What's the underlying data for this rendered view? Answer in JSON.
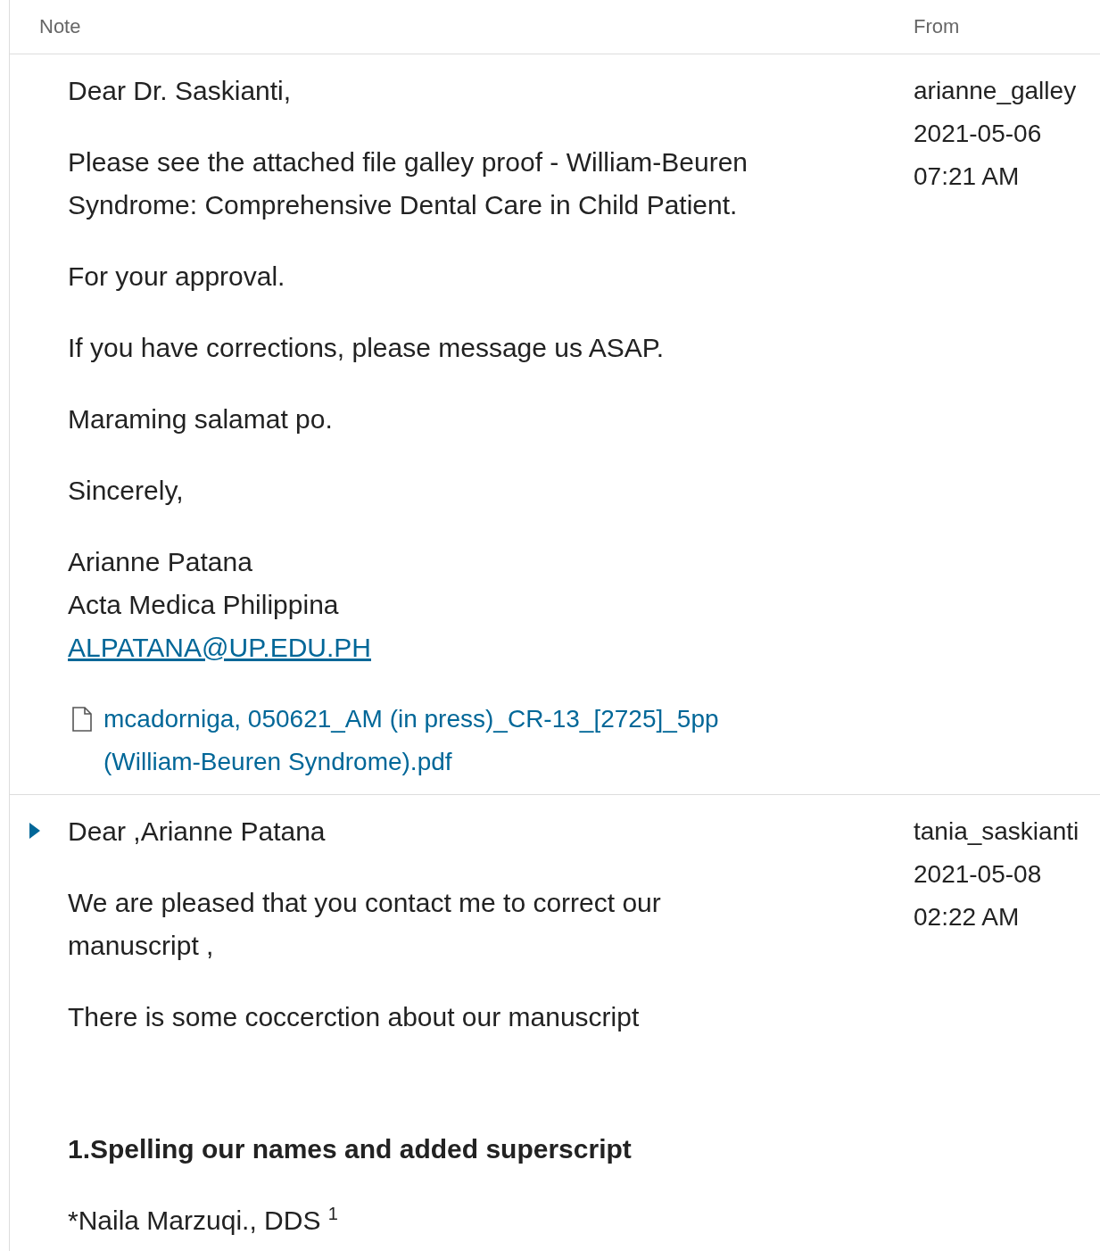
{
  "columns": {
    "note": "Note",
    "from": "From"
  },
  "notes": [
    {
      "indicator": false,
      "blocks": [
        {
          "kind": "text",
          "text": "Dear Dr. Saskianti,"
        },
        {
          "kind": "text",
          "text": "Please see the attached file galley proof - William-Beuren Syndrome: Comprehensive Dental Care in Child Patient."
        },
        {
          "kind": "text",
          "text": "For your approval."
        },
        {
          "kind": "text",
          "text": "If you have corrections, please message us ASAP."
        },
        {
          "kind": "text",
          "text": "Maraming salamat po."
        },
        {
          "kind": "text",
          "text": "Sincerely,"
        },
        {
          "kind": "signature",
          "lines": [
            "Arianne Patana",
            "Acta Medica Philippina"
          ],
          "link": "ALPATANA@UP.EDU.PH"
        },
        {
          "kind": "attachment",
          "text": "mcadorniga, 050621_AM (in press)_CR-13_[2725]_5pp (William-Beuren Syndrome).pdf"
        }
      ],
      "from": {
        "user": "arianne_galley",
        "date": "2021-05-06",
        "time": "07:21 AM"
      }
    },
    {
      "indicator": true,
      "blocks": [
        {
          "kind": "text",
          "text": "Dear ,Arianne Patana"
        },
        {
          "kind": "text",
          "text": "We are pleased that you contact me to correct our manuscript ,"
        },
        {
          "kind": "text",
          "text": "There is some coccerction about our manuscript"
        },
        {
          "kind": "heading",
          "text": "1.Spelling our names and added superscript"
        },
        {
          "kind": "footnoted",
          "text": "*Naila Marzuqi., DDS",
          "sup": "1"
        }
      ],
      "from": {
        "user": "tania_saskianti",
        "date": "2021-05-08",
        "time": "02:22 AM"
      }
    }
  ]
}
